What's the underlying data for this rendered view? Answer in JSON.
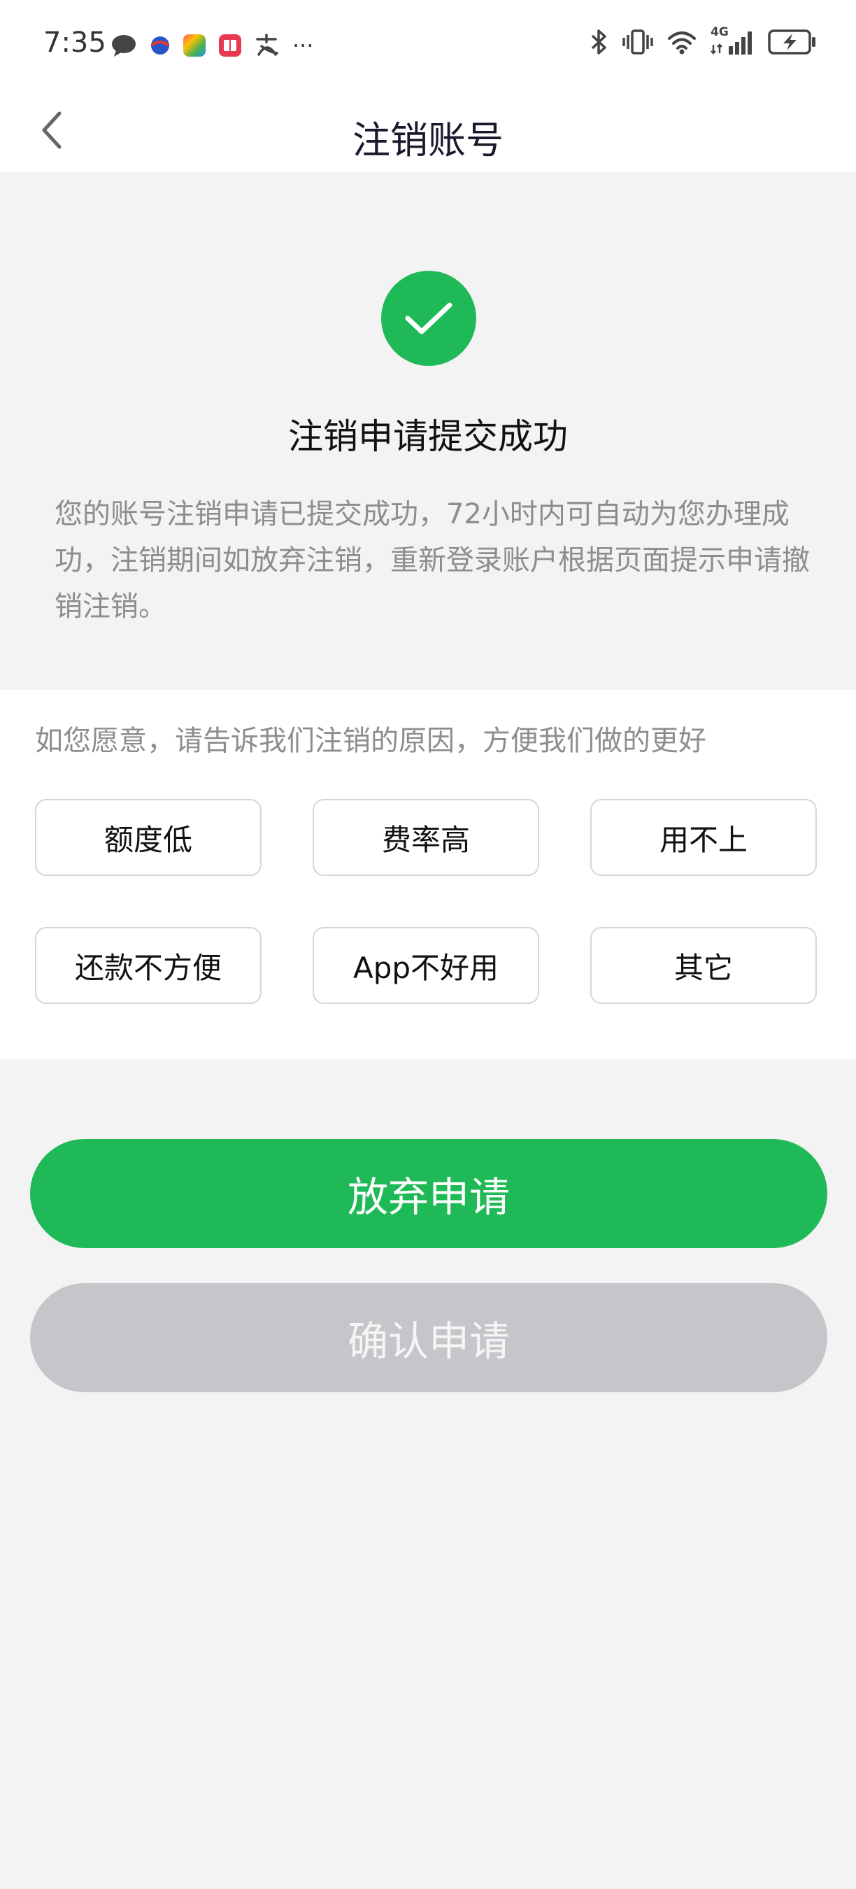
{
  "status_bar": {
    "time": "7:35",
    "more": "···",
    "network": "4G",
    "icons_left": [
      "chat-bubble-icon",
      "globe-app-icon",
      "colorful-app-icon",
      "red-book-icon",
      "alipay-icon"
    ],
    "icons_right": [
      "bluetooth-icon",
      "vibrate-icon",
      "wifi-icon",
      "signal-icon",
      "battery-charging-icon"
    ]
  },
  "nav": {
    "title": "注销账号",
    "back_icon": "chevron-left-icon"
  },
  "result": {
    "icon": "check-circle-icon",
    "title": "注销申请提交成功",
    "description": "您的账号注销申请已提交成功，72小时内可自动为您办理成功，注销期间如放弃注销，重新登录账户根据页面提示申请撤销注销。"
  },
  "reasons": {
    "prompt": "如您愿意，请告诉我们注销的原因，方便我们做的更好",
    "options": [
      "额度低",
      "费率高",
      "用不上",
      "还款不方便",
      "App不好用",
      "其它"
    ]
  },
  "actions": {
    "primary_label": "放弃申请",
    "secondary_label": "确认申请"
  },
  "colors": {
    "accent": "#1fba57",
    "disabled": "#c5c6ca",
    "background": "#f3f3f3"
  }
}
